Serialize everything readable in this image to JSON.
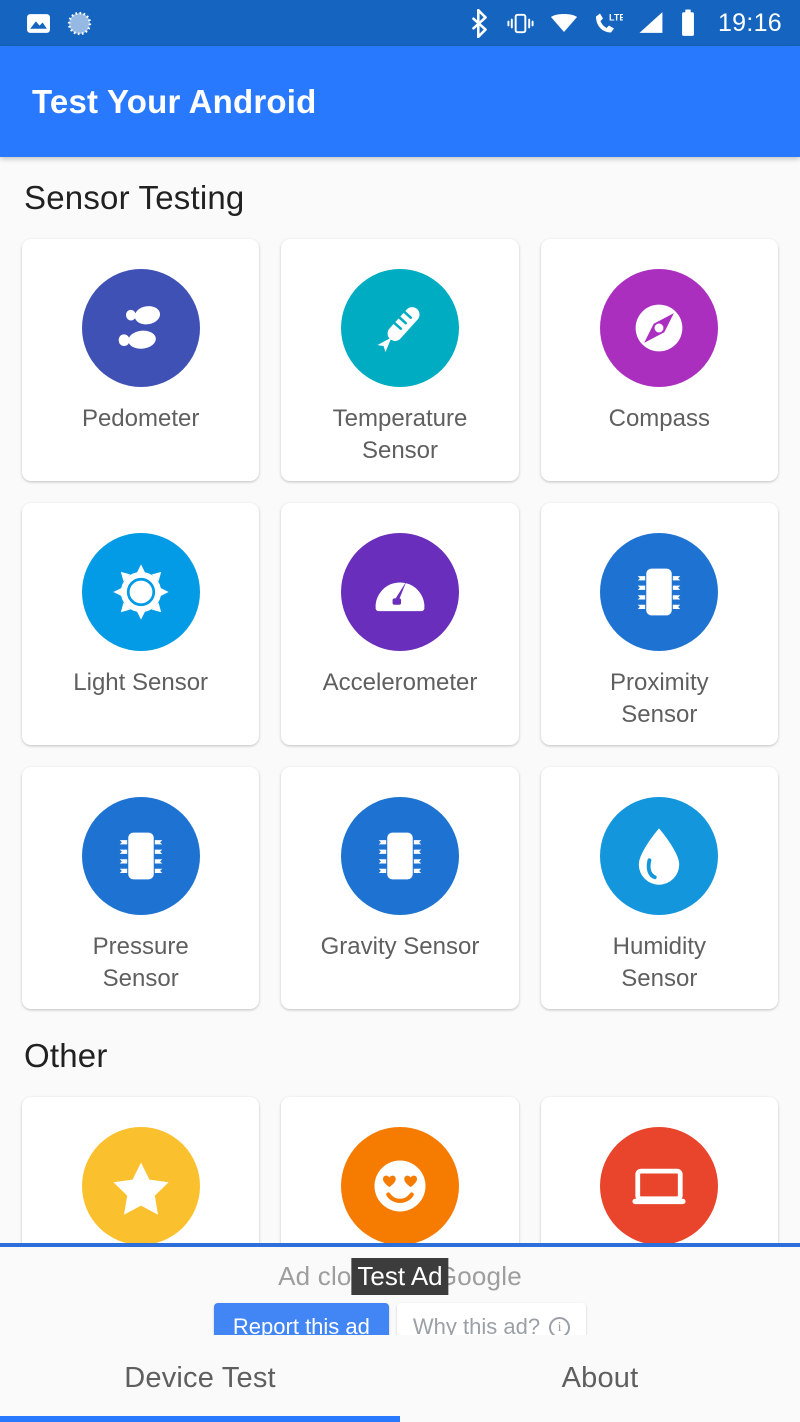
{
  "status_bar": {
    "clock": "19:16",
    "left_icons": [
      "image-icon",
      "sync-progress-icon"
    ],
    "right_icons": [
      "bluetooth-icon",
      "vibrate-icon",
      "wifi-icon",
      "lte-call-icon",
      "signal-icon",
      "battery-icon"
    ],
    "background": "#1565C0"
  },
  "app_bar": {
    "title": "Test Your Android",
    "background": "#2979FF"
  },
  "sections": [
    {
      "title": "Sensor Testing",
      "cards": [
        {
          "label": "Pedometer",
          "icon": "footsteps-icon",
          "color": "#3F51B5"
        },
        {
          "label": "Temperature\nSensor",
          "icon": "thermometer-icon",
          "color": "#00ACC1"
        },
        {
          "label": "Compass",
          "icon": "compass-icon",
          "color": "#AB2FBF"
        },
        {
          "label": "Light Sensor",
          "icon": "sun-icon",
          "color": "#039BE5"
        },
        {
          "label": "Accelerometer",
          "icon": "gauge-icon",
          "color": "#6A2EBD"
        },
        {
          "label": "Proximity\nSensor",
          "icon": "chip-icon",
          "color": "#1E73D2"
        },
        {
          "label": "Pressure\nSensor",
          "icon": "chip-icon",
          "color": "#1E73D2"
        },
        {
          "label": "Gravity Sensor",
          "icon": "chip-icon",
          "color": "#1E73D2"
        },
        {
          "label": "Humidity\nSensor",
          "icon": "droplet-icon",
          "color": "#1496DC"
        }
      ]
    },
    {
      "title": "Other",
      "cards": [
        {
          "label": "",
          "icon": "star-icon",
          "color": "#FBC02D"
        },
        {
          "label": "",
          "icon": "heart-eyes-icon",
          "color": "#F57C00"
        },
        {
          "label": "",
          "icon": "device-icon",
          "color": "#E8452C"
        }
      ]
    }
  ],
  "ad": {
    "closed_text": "Ad closed by Google",
    "test_badge": "Test Ad",
    "report_label": "Report this ad",
    "why_label": "Why this ad?",
    "accent": "#4285F4",
    "border_color": "#2c6fdb"
  },
  "tabs": [
    {
      "label": "Device Test",
      "active": true
    },
    {
      "label": "About",
      "active": false
    }
  ]
}
